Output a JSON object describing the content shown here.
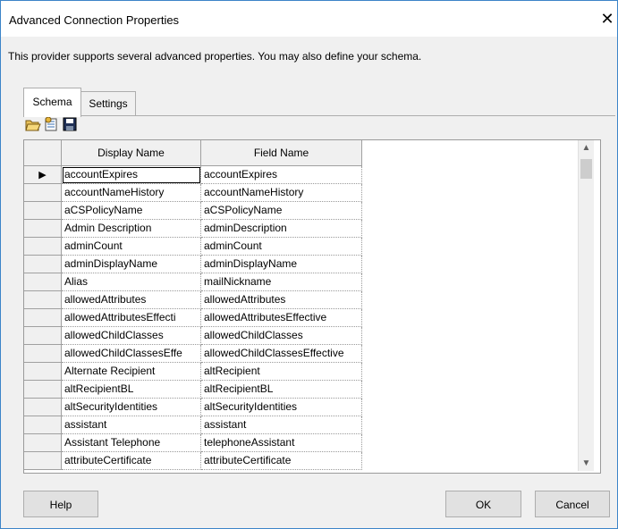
{
  "window": {
    "title": "Advanced Connection Properties",
    "close_glyph": "✕",
    "description": "This provider supports several advanced properties.  You may also define your schema."
  },
  "tabs": [
    {
      "label": "Schema",
      "selected": true
    },
    {
      "label": "Settings",
      "selected": false
    }
  ],
  "toolbar": {
    "icons": [
      "open-folder-icon",
      "schema-edit-icon",
      "save-disk-icon"
    ]
  },
  "grid": {
    "columns": {
      "display_name": "Display Name",
      "field_name": "Field Name"
    },
    "current_row_marker": "▶",
    "rows": [
      {
        "display_name": "accountExpires",
        "field_name": "accountExpires"
      },
      {
        "display_name": "accountNameHistory",
        "field_name": "accountNameHistory"
      },
      {
        "display_name": "aCSPolicyName",
        "field_name": "aCSPolicyName"
      },
      {
        "display_name": "Admin Description",
        "field_name": "adminDescription"
      },
      {
        "display_name": "adminCount",
        "field_name": "adminCount"
      },
      {
        "display_name": "adminDisplayName",
        "field_name": "adminDisplayName"
      },
      {
        "display_name": "Alias",
        "field_name": "mailNickname"
      },
      {
        "display_name": "allowedAttributes",
        "field_name": "allowedAttributes"
      },
      {
        "display_name": "allowedAttributesEffecti",
        "field_name": "allowedAttributesEffective"
      },
      {
        "display_name": "allowedChildClasses",
        "field_name": "allowedChildClasses"
      },
      {
        "display_name": "allowedChildClassesEffe",
        "field_name": "allowedChildClassesEffective"
      },
      {
        "display_name": "Alternate Recipient",
        "field_name": "altRecipient"
      },
      {
        "display_name": "altRecipientBL",
        "field_name": "altRecipientBL"
      },
      {
        "display_name": "altSecurityIdentities",
        "field_name": "altSecurityIdentities"
      },
      {
        "display_name": "assistant",
        "field_name": "assistant"
      },
      {
        "display_name": "Assistant Telephone",
        "field_name": "telephoneAssistant"
      },
      {
        "display_name": "attributeCertificate",
        "field_name": "attributeCertificate"
      }
    ]
  },
  "buttons": {
    "help": "Help",
    "ok": "OK",
    "cancel": "Cancel"
  },
  "colors": {
    "window_border": "#3c84c8",
    "dialog_bg": "#f0f0f0",
    "grid_bg": "#ffffff"
  }
}
